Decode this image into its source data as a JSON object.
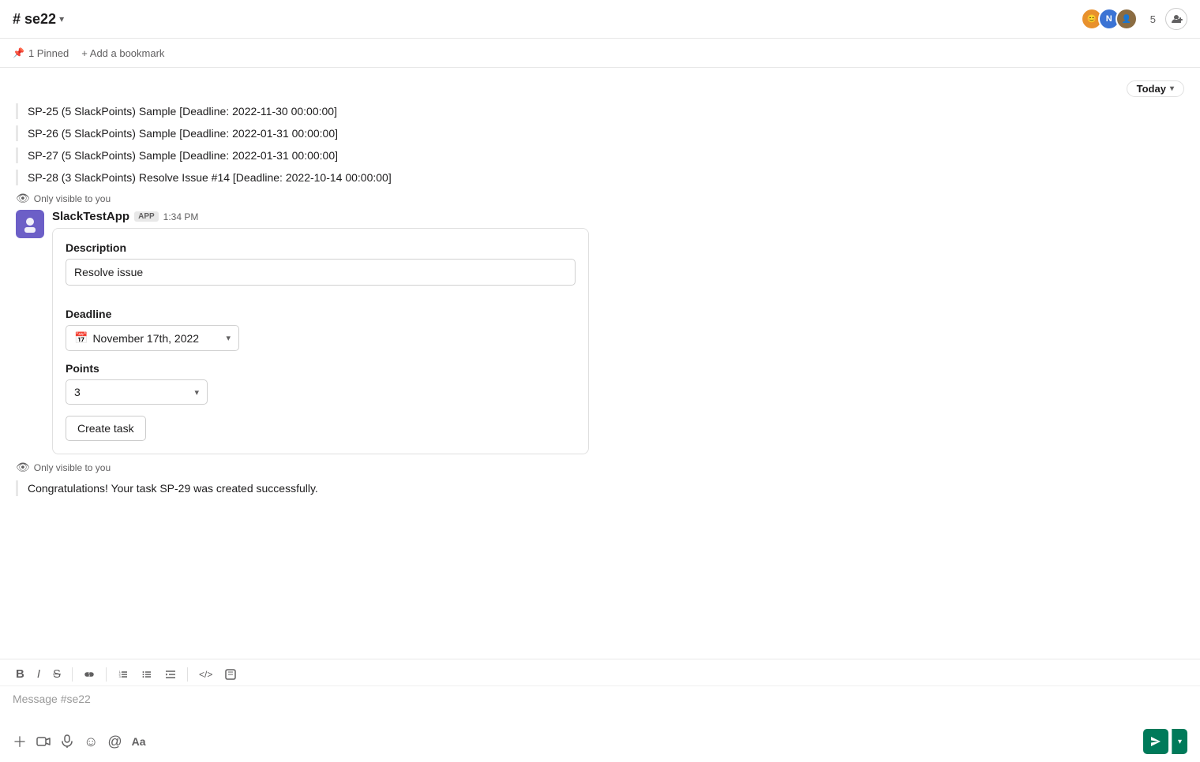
{
  "header": {
    "channel_name": "# se22",
    "chevron": "▾",
    "members_count": "5",
    "add_member_label": "+"
  },
  "bookmarks": {
    "pinned_label": "1 Pinned",
    "add_bookmark_label": "+ Add a bookmark"
  },
  "messages": [
    "SP-25 (5 SlackPoints) Sample [Deadline: 2022-11-30 00:00:00]",
    "SP-26 (5 SlackPoints) Sample [Deadline: 2022-01-31 00:00:00]",
    "SP-27 (5 SlackPoints) Sample [Deadline: 2022-01-31 00:00:00]",
    "SP-28 (3 SlackPoints) Resolve Issue #14 [Deadline: 2022-10-14 00:00:00]"
  ],
  "today_badge": "Today",
  "visibility_notice_1": "Only visible to you",
  "bot": {
    "name": "SlackTestApp",
    "badge": "APP",
    "time": "1:34 PM"
  },
  "form": {
    "description_label": "Description",
    "description_value": "Resolve issue",
    "description_placeholder": "Resolve issue",
    "deadline_label": "Deadline",
    "deadline_value": "November 17th, 2022",
    "points_label": "Points",
    "points_value": "3",
    "create_task_label": "Create task"
  },
  "visibility_notice_2": "Only visible to you",
  "success_message": "Congratulations! Your task SP-29 was created successfully.",
  "composer": {
    "placeholder": "Message #se22",
    "tools": {
      "bold": "B",
      "italic": "I",
      "strikethrough": "S",
      "link": "🔗",
      "ordered_list": "≡",
      "bullet_list": "≡",
      "indent": "≡",
      "code": "</>",
      "block": "⊡"
    }
  }
}
